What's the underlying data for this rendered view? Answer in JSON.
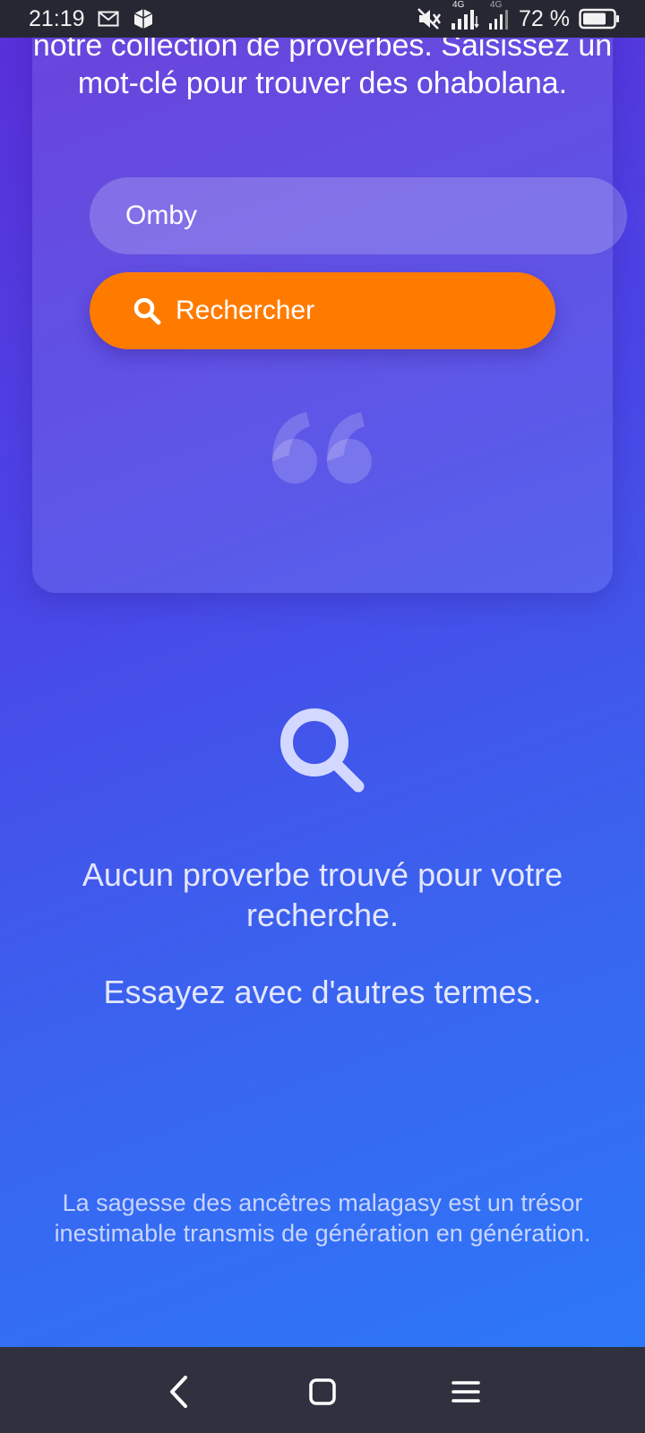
{
  "status_bar": {
    "time": "21:19",
    "battery_percent": "72 %",
    "network_1": "4G",
    "network_2": "4G",
    "icons": [
      "mail-icon",
      "app-icon",
      "mute-icon",
      "signal-icon",
      "signal-icon",
      "battery-icon"
    ]
  },
  "search": {
    "intro": "notre collection de proverbes. Saisissez un mot-clé pour trouver des ohabolana.",
    "input_value": "Omby",
    "button_label": "Rechercher"
  },
  "empty_state": {
    "title": "Aucun proverbe trouvé pour votre recherche.",
    "hint": "Essayez avec d'autres termes."
  },
  "footer": {
    "text": "La sagesse des ancêtres malagasy est un trésor inestimable transmis de génération en génération."
  },
  "colors": {
    "accent": "#ff7b00",
    "status_bar": "#262733",
    "nav_bar": "#2f313f"
  }
}
